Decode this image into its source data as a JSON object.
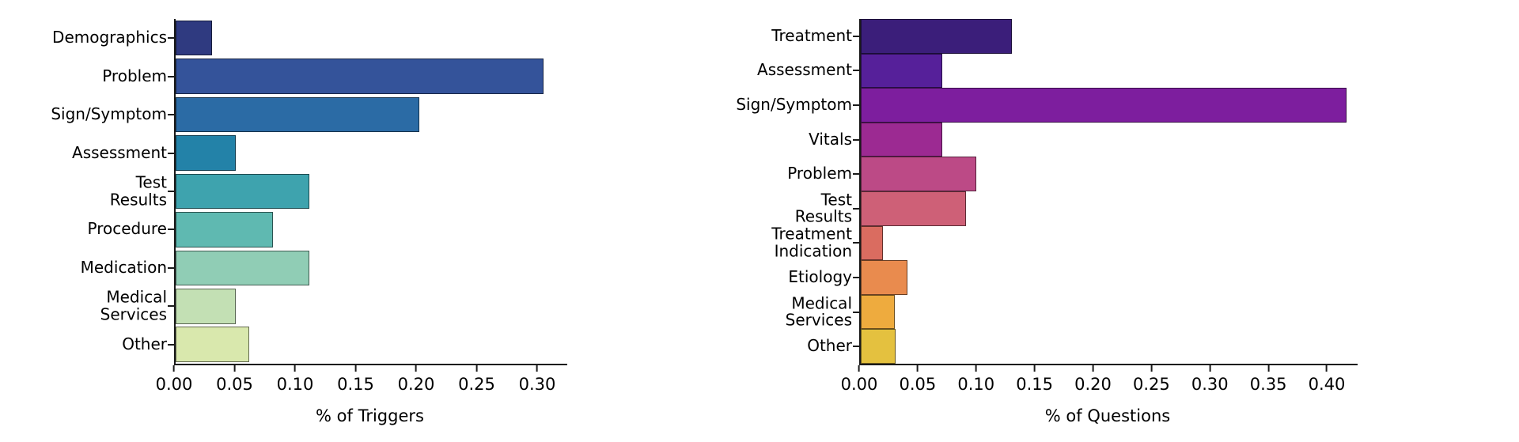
{
  "chart_data": [
    {
      "type": "bar",
      "orientation": "horizontal",
      "panel": "left",
      "title": "",
      "xlabel": "% of Triggers",
      "ylabel": "",
      "xlim": [
        0.0,
        0.3235
      ],
      "xticks": [
        "0.00",
        "0.05",
        "0.10",
        "0.15",
        "0.20",
        "0.25",
        "0.30"
      ],
      "xtick_values": [
        0.0,
        0.05,
        0.1,
        0.15,
        0.2,
        0.25,
        0.3
      ],
      "grid": false,
      "legend": "none",
      "categories": [
        "Demographics",
        "Problem",
        "Sign/Symptom",
        "Assessment",
        "Test Results",
        "Procedure",
        "Medication",
        "Medical Services",
        "Other"
      ],
      "values": [
        0.03,
        0.305,
        0.202,
        0.05,
        0.111,
        0.081,
        0.111,
        0.05,
        0.061
      ],
      "colors": [
        "#2f3a80",
        "#34539a",
        "#2b6ba5",
        "#2382a8",
        "#3ea3ae",
        "#5fb9b1",
        "#90cdb5",
        "#c3e0b4",
        "#d9e8ad"
      ]
    },
    {
      "type": "bar",
      "orientation": "horizontal",
      "panel": "right",
      "title": "",
      "xlabel": "% of Questions",
      "ylabel": "",
      "xlim": [
        0.0,
        0.425
      ],
      "xticks": [
        "0.00",
        "0.05",
        "0.10",
        "0.15",
        "0.20",
        "0.25",
        "0.30",
        "0.35",
        "0.40"
      ],
      "xtick_values": [
        0.0,
        0.05,
        0.1,
        0.15,
        0.2,
        0.25,
        0.3,
        0.35,
        0.4
      ],
      "grid": false,
      "legend": "none",
      "categories": [
        "Treatment",
        "Assessment",
        "Sign/Symptom",
        "Vitals",
        "Problem",
        "Test Results",
        "Treatment\nIndication",
        "Etiology",
        "Medical Services",
        "Other"
      ],
      "values": [
        0.13,
        0.07,
        0.417,
        0.07,
        0.099,
        0.09,
        0.019,
        0.04,
        0.029,
        0.03
      ],
      "colors": [
        "#3b1e7a",
        "#56209a",
        "#7d1e9e",
        "#9c2a92",
        "#bc4a86",
        "#ce6077",
        "#da6c60",
        "#e98b4e",
        "#eeab3e",
        "#e4c13f"
      ]
    }
  ]
}
